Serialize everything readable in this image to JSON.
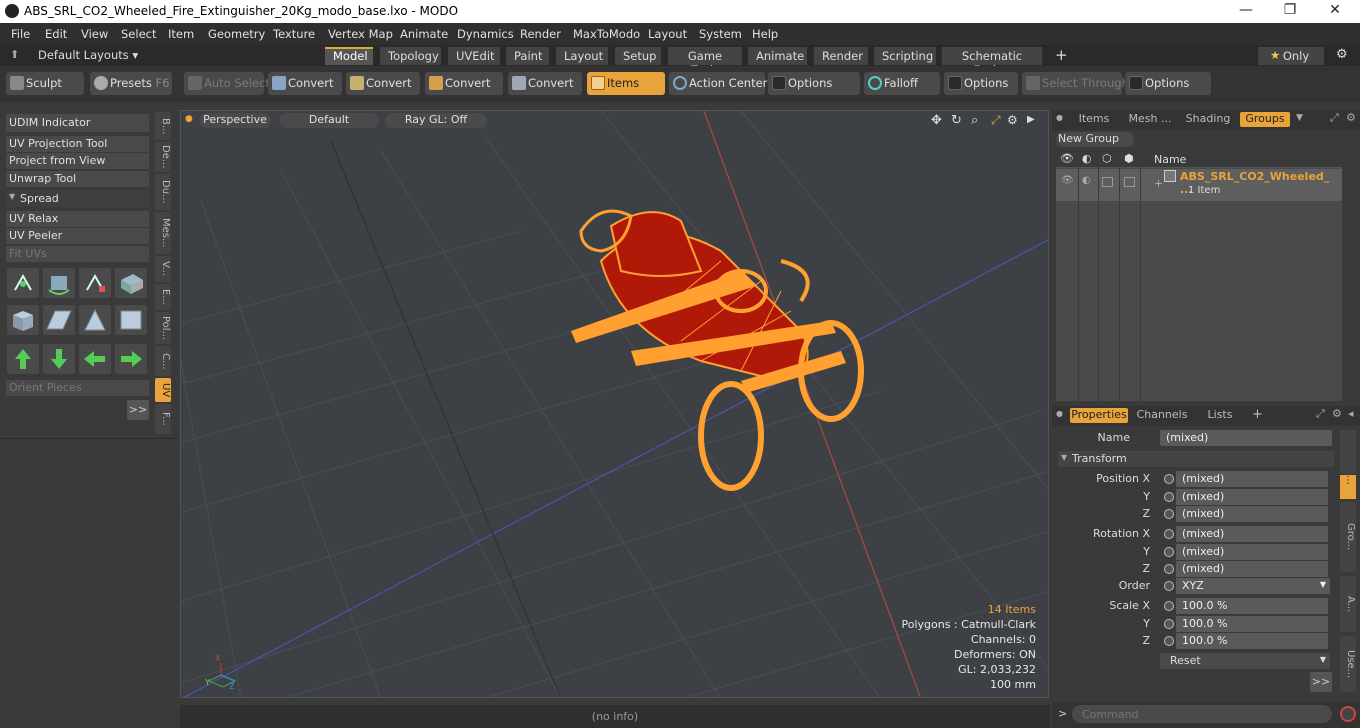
{
  "window": {
    "title": "ABS_SRL_CO2_Wheeled_Fire_Extinguisher_20Kg_modo_base.lxo - MODO",
    "minimize": "—",
    "maximize": "❐",
    "close": "✕"
  },
  "menu": [
    "File",
    "Edit",
    "View",
    "Select",
    "Item",
    "Geometry",
    "Texture",
    "Vertex Map",
    "Animate",
    "Dynamics",
    "Render",
    "MaxToModo",
    "Layout",
    "System",
    "Help"
  ],
  "layouts": {
    "label": "Default Layouts ▾",
    "tabs": [
      "Model",
      "Topology",
      "UVEdit",
      "Paint",
      "Layout",
      "Setup",
      "Game Tools",
      "Animate",
      "Render",
      "Scripting",
      "Schematic Fusion"
    ],
    "add": "+",
    "only": "Only"
  },
  "toolbar": {
    "sculpt": "Sculpt",
    "presets": "Presets",
    "presets_key": "F6",
    "auto_select": "Auto Select",
    "convert1": "Convert",
    "convert2": "Convert",
    "convert3": "Convert",
    "convert4": "Convert",
    "items": "Items",
    "action_center": "Action Center",
    "options1": "Options",
    "falloff": "Falloff",
    "options2": "Options",
    "select_through": "Select Through",
    "options3": "Options"
  },
  "left": {
    "udim": "UDIM Indicator",
    "uv_projection": "UV Projection Tool",
    "project_view": "Project from View",
    "unwrap": "Unwrap Tool",
    "spread": "Spread",
    "uv_relax": "UV Relax",
    "uv_peeler": "UV Peeler",
    "fit_uvs": "Fit UVs",
    "orient": "Orient Pieces",
    "more": ">>",
    "vtabs": [
      "B...",
      "De...",
      "Du...",
      "Mes...",
      "V...",
      "E...",
      "Pol...",
      "C...",
      "UV",
      "F..."
    ]
  },
  "viewport": {
    "perspective": "Perspective",
    "default": "Default",
    "raygl": "Ray GL: Off",
    "items": "14 Items",
    "polygons": "Polygons : Catmull-Clark",
    "channels": "Channels: 0",
    "deformers": "Deformers: ON",
    "gl": "GL: 2,033,232",
    "unit": "100 mm"
  },
  "groups": {
    "tabs": [
      "Items",
      "Mesh ...",
      "Shading",
      "Groups"
    ],
    "new_group": "New Group",
    "col_name": "Name",
    "row_name": "ABS_SRL_CO2_Wheeled_ ...",
    "row_sub": "1 Item"
  },
  "props": {
    "tabs": [
      "Properties",
      "Channels",
      "Lists"
    ],
    "add": "+",
    "name_label": "Name",
    "name_value": "(mixed)",
    "transform": "Transform",
    "pos_label": "Position X",
    "rot_label": "Rotation X",
    "y": "Y",
    "z": "Z",
    "mixed": "(mixed)",
    "order_label": "Order",
    "order_value": "XYZ",
    "scale_label": "Scale X",
    "scale_value": "100.0 %",
    "reset": "Reset",
    "more": ">>",
    "side": [
      "Gro...",
      "A...",
      "Use..."
    ]
  },
  "status": "(no info)",
  "command": {
    "prompt": ">",
    "placeholder": "Command"
  },
  "colors": {
    "accent": "#e8a33a",
    "wire": "#ffa030",
    "body": "#b01808"
  }
}
